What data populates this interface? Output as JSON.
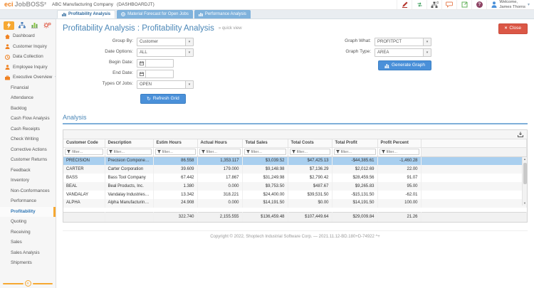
{
  "icons": {
    "caret_down": "▾",
    "close": "×",
    "refresh": "↻",
    "collapse": "«",
    "help": "?",
    "scroll_up": "▲",
    "scroll_down": "▼"
  },
  "header": {
    "logo_text": "eci",
    "brand": "JobBOSS²",
    "company": "ABC Manufacturing Company",
    "context": "(DASHBOARDJT)",
    "welcome_line1": "Welcome,",
    "welcome_line2": "James Thorns"
  },
  "tabs": [
    {
      "label": "Profitability Analysis"
    },
    {
      "label": "Material Forecast for Open Jobs"
    },
    {
      "label": "Performance Analysis"
    }
  ],
  "sidebar": {
    "items": [
      {
        "label": "Dashboard"
      },
      {
        "label": "Customer Inquiry"
      },
      {
        "label": "Data Collection"
      },
      {
        "label": "Employee Inquiry"
      },
      {
        "label": "Executive Overview"
      }
    ],
    "subitems": [
      "Financial",
      "Attendance",
      "Backlog",
      "Cash Flow Analysis",
      "Cash Receipts",
      "Check Writing",
      "Corrective Actions",
      "Customer Returns",
      "Feedback",
      "Inventory",
      "Non-Conformances",
      "Performance",
      "Profitability",
      "Quoting",
      "Receiving",
      "Sales",
      "Sales Analysis",
      "Shipments"
    ],
    "active_subitem": "Profitability"
  },
  "page": {
    "title": "Profitability Analysis : Profitability Analysis",
    "quick_view": "» quick view",
    "close_label": "Close"
  },
  "form": {
    "left": [
      {
        "label": "Group By:",
        "value": "Customer"
      },
      {
        "label": "Date Options:",
        "value": "ALL"
      },
      {
        "label": "Begin Date:",
        "value": ""
      },
      {
        "label": "End Date:",
        "value": ""
      },
      {
        "label": "Types Of Jobs:",
        "value": "OPEN"
      }
    ],
    "refresh_label": "Refresh Grid",
    "right": [
      {
        "label": "Graph What:",
        "value": "PROFITPCT"
      },
      {
        "label": "Graph Type:",
        "value": "AREA"
      }
    ],
    "generate_label": "Generate Graph"
  },
  "analysis": {
    "section_title": "Analysis",
    "filter_placeholder": "filter...",
    "columns": [
      "Customer Code",
      "Description",
      "Estim Hours",
      "Actual Hours",
      "Total Sales",
      "Total Costs",
      "Total Profit",
      "Profit Percent"
    ],
    "rows": [
      [
        "PRECISION",
        "Precision Components,...",
        "86.558",
        "1,353.117",
        "$3,039.52",
        "$47,425.13",
        "-$44,385.61",
        "-1,460.28"
      ],
      [
        "CARTER",
        "Carter Corporation",
        "39.609",
        "179.000",
        "$9,148.98",
        "$7,136.29",
        "$2,012.69",
        "22.00"
      ],
      [
        "BASS",
        "Bass Tool Company",
        "67.442",
        "17.867",
        "$31,249.98",
        "$2,790.42",
        "$28,459.56",
        "91.07"
      ],
      [
        "BEAL",
        "Beal Products, Inc.",
        "1.380",
        "0.000",
        "$9,753.50",
        "$487.67",
        "$9,265.83",
        "95.00"
      ],
      [
        "VANDALAY",
        "Vandalay Industries, Inc.",
        "13.342",
        "318.221",
        "$24,400.00",
        "$39,531.50",
        "-$15,131.50",
        "-62.01"
      ],
      [
        "ALPHA",
        "Alpha Manufacturing, I...",
        "24.908",
        "0.000",
        "$14,191.50",
        "$0.00",
        "$14,191.50",
        "100.00"
      ]
    ],
    "selected_row": "PRECISION",
    "totals": [
      "",
      "",
      "322.740",
      "2,155.555",
      "$136,459.48",
      "$107,449.64",
      "$29,009.84",
      "21.26"
    ]
  },
  "footer": {
    "copyright": "Copyright © 2022, Shoptech Industrial Software Corp. — 2021.11.12-BD.180+D-74922 ^+"
  }
}
